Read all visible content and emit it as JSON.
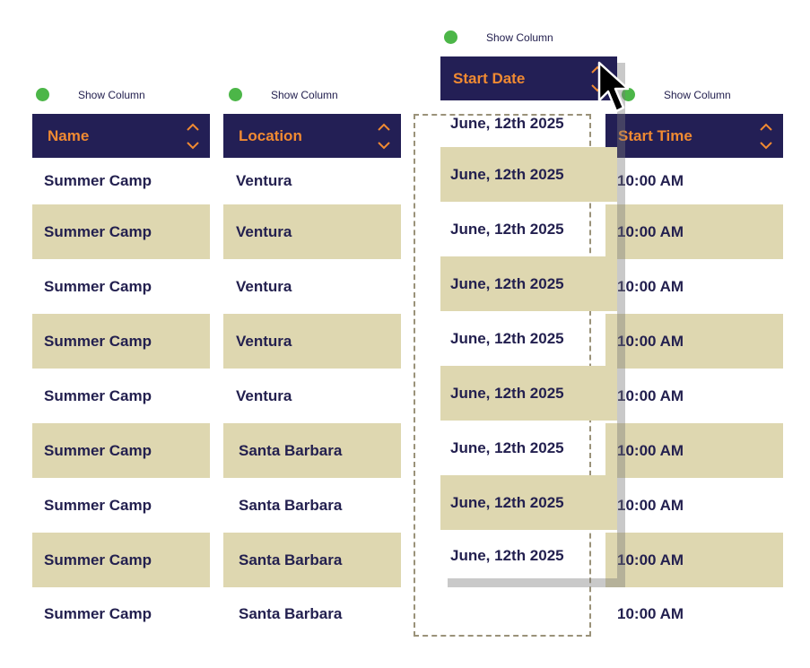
{
  "toggle_label": "Show Column",
  "colors": {
    "header_bg": "#231f55",
    "header_text": "#f08a32",
    "row_alt": "#ded7b0",
    "text": "#23204f",
    "toggle_on": "#4cb648"
  },
  "columns": [
    {
      "title": "Name",
      "toggle": "Show Column",
      "cells": [
        "Summer Camp",
        "Summer Camp",
        "Summer Camp",
        "Summer Camp",
        "Summer Camp",
        "Summer Camp",
        "Summer Camp",
        "Summer Camp",
        "Summer Camp"
      ]
    },
    {
      "title": "Location",
      "toggle": "Show Column",
      "cells": [
        "Ventura",
        "Ventura",
        "Ventura",
        "Ventura",
        "Ventura",
        "Santa Barbara",
        "Santa Barbara",
        "Santa Barbara",
        "Santa Barbara"
      ]
    },
    {
      "title": "Start Date",
      "toggle": "Show Column",
      "dragging": true,
      "cells": [
        "June, 12th 2025",
        "June, 12th 2025",
        "June, 12th 2025",
        "June, 12th 2025",
        "June, 12th 2025",
        "June, 12th 2025",
        "June, 12th 2025",
        "June, 12th 2025",
        "June, 12th 2025"
      ]
    },
    {
      "title": "Start Time",
      "toggle": "Show Column",
      "cells": [
        "10:00 AM",
        "10:00 AM",
        "10:00 AM",
        "10:00 AM",
        "10:00 AM",
        "10:00 AM",
        "10:00 AM",
        "10:00 AM",
        "10:00 AM"
      ]
    }
  ]
}
